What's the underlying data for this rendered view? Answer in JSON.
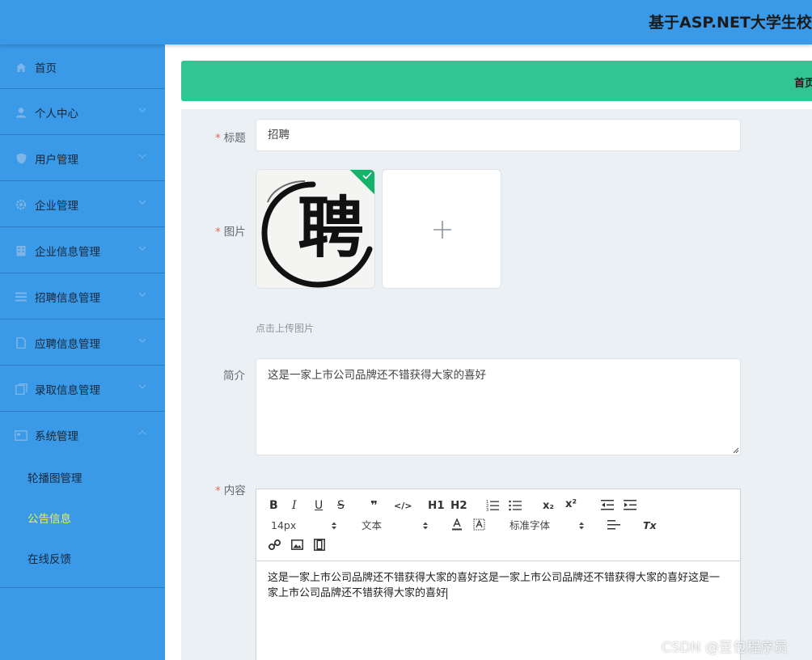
{
  "app": {
    "title": "基于ASP.NET大学生校"
  },
  "sidebar": {
    "items": [
      {
        "label": "首页",
        "icon": "home-icon"
      },
      {
        "label": "个人中心",
        "icon": "user-icon"
      },
      {
        "label": "用户管理",
        "icon": "shield-icon"
      },
      {
        "label": "企业管理",
        "icon": "gear-icon"
      },
      {
        "label": "企业信息管理",
        "icon": "building-icon"
      },
      {
        "label": "招聘信息管理",
        "icon": "list-icon"
      },
      {
        "label": "应聘信息管理",
        "icon": "document-icon"
      },
      {
        "label": "录取信息管理",
        "icon": "files-icon"
      },
      {
        "label": "系统管理",
        "icon": "monitor-icon"
      }
    ],
    "subitems": [
      {
        "label": "轮播图管理"
      },
      {
        "label": "公告信息"
      },
      {
        "label": "在线反馈"
      }
    ],
    "active_subitem": "公告信息"
  },
  "breadcrumb": {
    "home": "首页"
  },
  "form": {
    "title": {
      "label": "标题",
      "value": "招聘"
    },
    "image": {
      "label": "图片",
      "hint": "点击上传图片",
      "thumb_text": "聘"
    },
    "intro": {
      "label": "简介",
      "value": "这是一家上市公司品牌还不错获得大家的喜好"
    },
    "content": {
      "label": "内容",
      "value": "这是一家上市公司品牌还不错获得大家的喜好这是一家上市公司品牌还不错获得大家的喜好这是一家上市公司品牌还不错获得大家的喜好"
    }
  },
  "editor_toolbar": {
    "bold": "B",
    "italic": "I",
    "underline": "U",
    "strike": "S",
    "quote": "❞",
    "code": "</>",
    "h1": "H1",
    "h2": "H2",
    "subscript": "x₂",
    "superscript": "x²",
    "clear": "Tx",
    "font_size": "14px",
    "text_type": "文本",
    "font_family": "标准字体"
  },
  "watermark": "CSDN @豆包程序员",
  "colors": {
    "header": "#3a9ae8",
    "sidebar": "#3a9ae8",
    "breadcrumb_bar": "#30c593",
    "active_subitem": "#e8f050",
    "required": "#ee5f5f",
    "success_check": "#14b36a"
  }
}
